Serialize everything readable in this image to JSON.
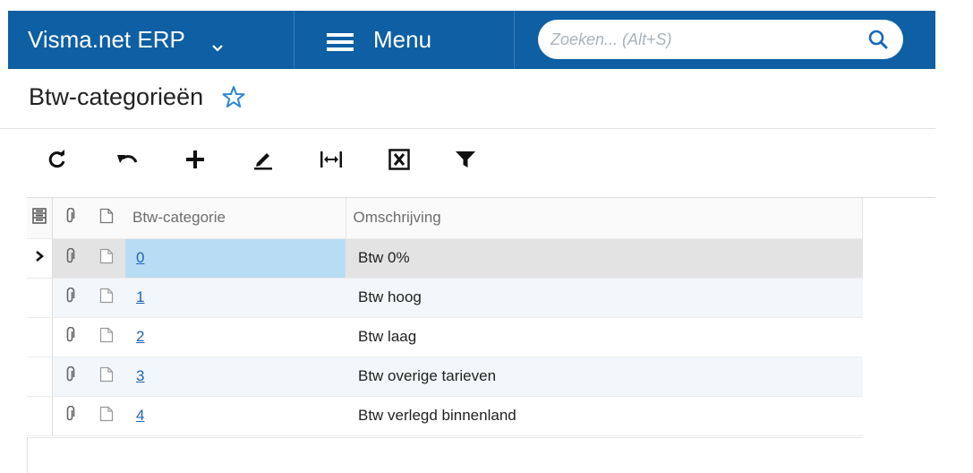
{
  "app": {
    "title": "Visma.net ERP",
    "menu_label": "Menu",
    "search_placeholder": "Zoeken... (Alt+S)",
    "accent_color": "#0e5fa3"
  },
  "page": {
    "title": "Btw-categorieën"
  },
  "toolbar": {
    "icons": [
      "refresh-icon",
      "undo-icon",
      "add-icon",
      "edit-icon",
      "fit-columns-icon",
      "export-excel-icon",
      "filter-icon"
    ]
  },
  "grid": {
    "columns": {
      "category": "Btw-categorie",
      "description": "Omschrijving"
    },
    "rows": [
      {
        "category": "0",
        "description": "Btw 0%"
      },
      {
        "category": "1",
        "description": "Btw hoog"
      },
      {
        "category": "2",
        "description": "Btw laag"
      },
      {
        "category": "3",
        "description": "Btw overige tarieven"
      },
      {
        "category": "4",
        "description": "Btw verlegd binnenland"
      }
    ],
    "selected_row": 0
  }
}
